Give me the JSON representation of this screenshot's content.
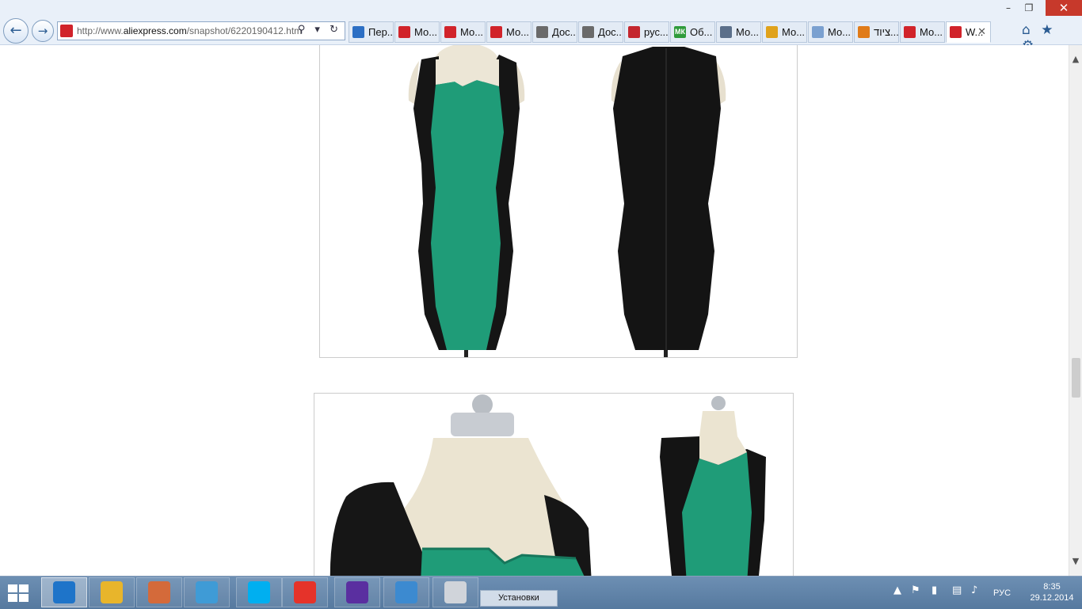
{
  "browser": {
    "address": {
      "url_prefix": "http://www.",
      "url_domain": "aliexpress.com",
      "url_path": "/snapshot/6220190412.htm",
      "tools": "⚲ ▾ ↻"
    },
    "tabs": [
      {
        "label": "Пер...",
        "icon": "translate-icon",
        "color": "#2d6fc4"
      },
      {
        "label": "Мо...",
        "icon": "cart-icon",
        "color": "#d1232a"
      },
      {
        "label": "Мо...",
        "icon": "cart-icon",
        "color": "#d1232a"
      },
      {
        "label": "Мо...",
        "icon": "cart-icon",
        "color": "#d1232a"
      },
      {
        "label": "Дос...",
        "icon": "list-icon",
        "color": "#6a6a6a"
      },
      {
        "label": "Дос...",
        "icon": "list-icon",
        "color": "#6a6a6a"
      },
      {
        "label": "рус...",
        "icon": "record-icon",
        "color": "#c4262e"
      },
      {
        "label": "Об...",
        "icon": "mk-icon",
        "color": "#2f9b3b",
        "badge": "МК"
      },
      {
        "label": "Мо...",
        "icon": "globe-icon",
        "color": "#5b6f8a"
      },
      {
        "label": "Мо...",
        "icon": "cup-icon",
        "color": "#e0a21b"
      },
      {
        "label": "Мо...",
        "icon": "person-icon",
        "color": "#7aa0d0"
      },
      {
        "label": "ציוד...",
        "icon": "flag-icon",
        "color": "#e07b18"
      },
      {
        "label": "Мо...",
        "icon": "cart-icon",
        "color": "#d1232a"
      },
      {
        "label": "W...",
        "icon": "cart-icon",
        "color": "#d1232a",
        "active": true
      }
    ],
    "right_tools": {
      "home": "⌂",
      "favorites": "★",
      "settings": "⚙"
    },
    "window": {
      "minimize": "–",
      "restore": "❐",
      "close": "✕"
    }
  },
  "scrollbar": {
    "up": "▲",
    "down": "▼"
  },
  "taskbar": {
    "items": [
      {
        "name": "ie",
        "color": "#1e74c9"
      },
      {
        "name": "explorer",
        "color": "#e8b52b"
      },
      {
        "name": "paint",
        "color": "#d46a3a"
      },
      {
        "name": "notepad",
        "color": "#3f9bd6"
      },
      {
        "name": "skype",
        "color": "#00aff0"
      },
      {
        "name": "yandex",
        "color": "#e5332a"
      },
      {
        "name": "settings",
        "color": "#5a2fa0"
      },
      {
        "name": "network",
        "color": "#3c8ad0"
      },
      {
        "name": "headset",
        "color": "#d0d4da"
      }
    ],
    "installs_label": "Установки",
    "tray": {
      "arrow": "▲",
      "flag": "⚑",
      "lang": "РУС"
    },
    "clock": {
      "time": "8:35",
      "date": "29.12.2014"
    }
  }
}
